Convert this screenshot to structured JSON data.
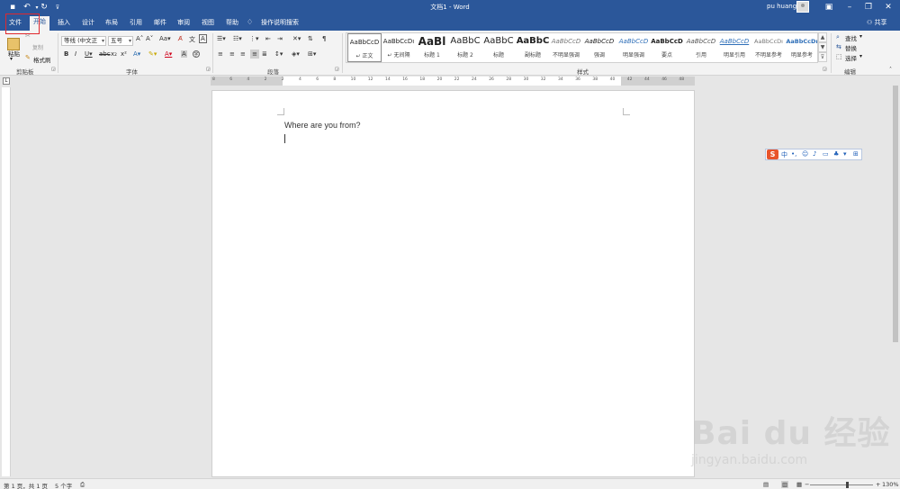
{
  "titlebar": {
    "doc_title": "文档1 - Word",
    "user_name": "pu huang",
    "qa_icons": [
      "save-icon",
      "undo-icon",
      "redo-icon",
      "customize-icon"
    ]
  },
  "tabs": [
    {
      "label": "文件"
    },
    {
      "label": "开始"
    },
    {
      "label": "插入"
    },
    {
      "label": "设计"
    },
    {
      "label": "布局"
    },
    {
      "label": "引用"
    },
    {
      "label": "邮件"
    },
    {
      "label": "审阅"
    },
    {
      "label": "视图"
    },
    {
      "label": "帮助"
    }
  ],
  "tell_me": "操作说明搜索",
  "share": "共享",
  "clipboard": {
    "paste": "粘贴",
    "cut": "✂",
    "copy": "复制",
    "format_painter": "格式刷",
    "group": "剪贴板"
  },
  "font": {
    "family": "等线 (中文正",
    "size": "五号",
    "group": "字体"
  },
  "paragraph": {
    "group": "段落"
  },
  "styles": {
    "group": "样式",
    "items": [
      {
        "sample": "AaBbCcD",
        "name": "↵ 正文"
      },
      {
        "sample": "AaBbCcDı",
        "name": "↵ 无间隔"
      },
      {
        "sample": "AaBl",
        "name": "标题 1"
      },
      {
        "sample": "AaBbC",
        "name": "标题 2"
      },
      {
        "sample": "AaBbC",
        "name": "标题"
      },
      {
        "sample": "AaBbC",
        "name": "副标题"
      },
      {
        "sample": "AaBbCcD",
        "name": "不明显强调"
      },
      {
        "sample": "AaBbCcD",
        "name": "强调"
      },
      {
        "sample": "AaBbCcD",
        "name": "明显强调"
      },
      {
        "sample": "AaBbCcD",
        "name": "要点"
      },
      {
        "sample": "AaBbCcD",
        "name": "引用"
      },
      {
        "sample": "AaBbCcD",
        "name": "明显引用"
      },
      {
        "sample": "AaBbCcDı",
        "name": "不明显参考"
      },
      {
        "sample": "AaBbCcDı",
        "name": "明显参考"
      }
    ]
  },
  "editing": {
    "find": "查找",
    "replace": "替换",
    "select": "选择",
    "group": "编辑"
  },
  "ruler_ticks": [
    "8",
    "6",
    "4",
    "2",
    "2",
    "4",
    "6",
    "8",
    "10",
    "12",
    "14",
    "16",
    "18",
    "20",
    "22",
    "24",
    "26",
    "28",
    "30",
    "32",
    "34",
    "36",
    "38",
    "40",
    "42",
    "44",
    "46",
    "48"
  ],
  "document": {
    "text": "Where are you from?"
  },
  "ime": {
    "logo": "S",
    "mode": "中"
  },
  "watermark": {
    "logo": "Bai du 经验",
    "url": "jingyan.baidu.com"
  },
  "status": {
    "page": "第 1 页，共 1 页",
    "words": "5 个字",
    "zoom": "130%"
  }
}
